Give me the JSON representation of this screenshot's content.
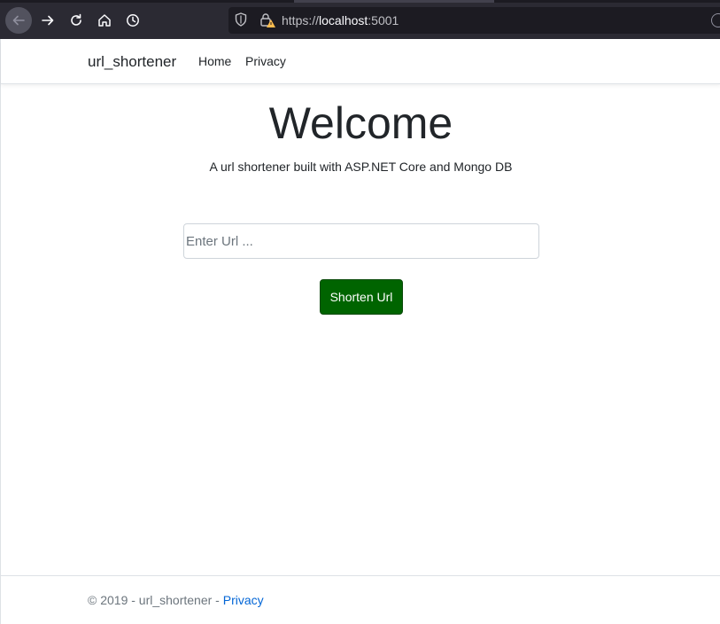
{
  "browser": {
    "url_scheme": "https://",
    "url_host": "localhost",
    "url_port": ":5001",
    "icons": [
      "back-arrow-icon",
      "forward-arrow-icon",
      "reload-icon",
      "home-icon",
      "history-clock-icon",
      "shield-icon",
      "insecure-lock-icon"
    ]
  },
  "navbar": {
    "brand": "url_shortener",
    "links": [
      "Home",
      "Privacy"
    ]
  },
  "main": {
    "heading": "Welcome",
    "subtitle": "A url shortener built with ASP.NET Core and Mongo DB",
    "input_placeholder": "Enter Url ...",
    "input_value": "",
    "button_label": "Shorten Url"
  },
  "footer": {
    "text": "© 2019 - url_shortener - ",
    "link": "Privacy"
  },
  "colors": {
    "button_bg": "#006400",
    "link": "#0366d6",
    "chrome_bg": "#2b2a33"
  }
}
